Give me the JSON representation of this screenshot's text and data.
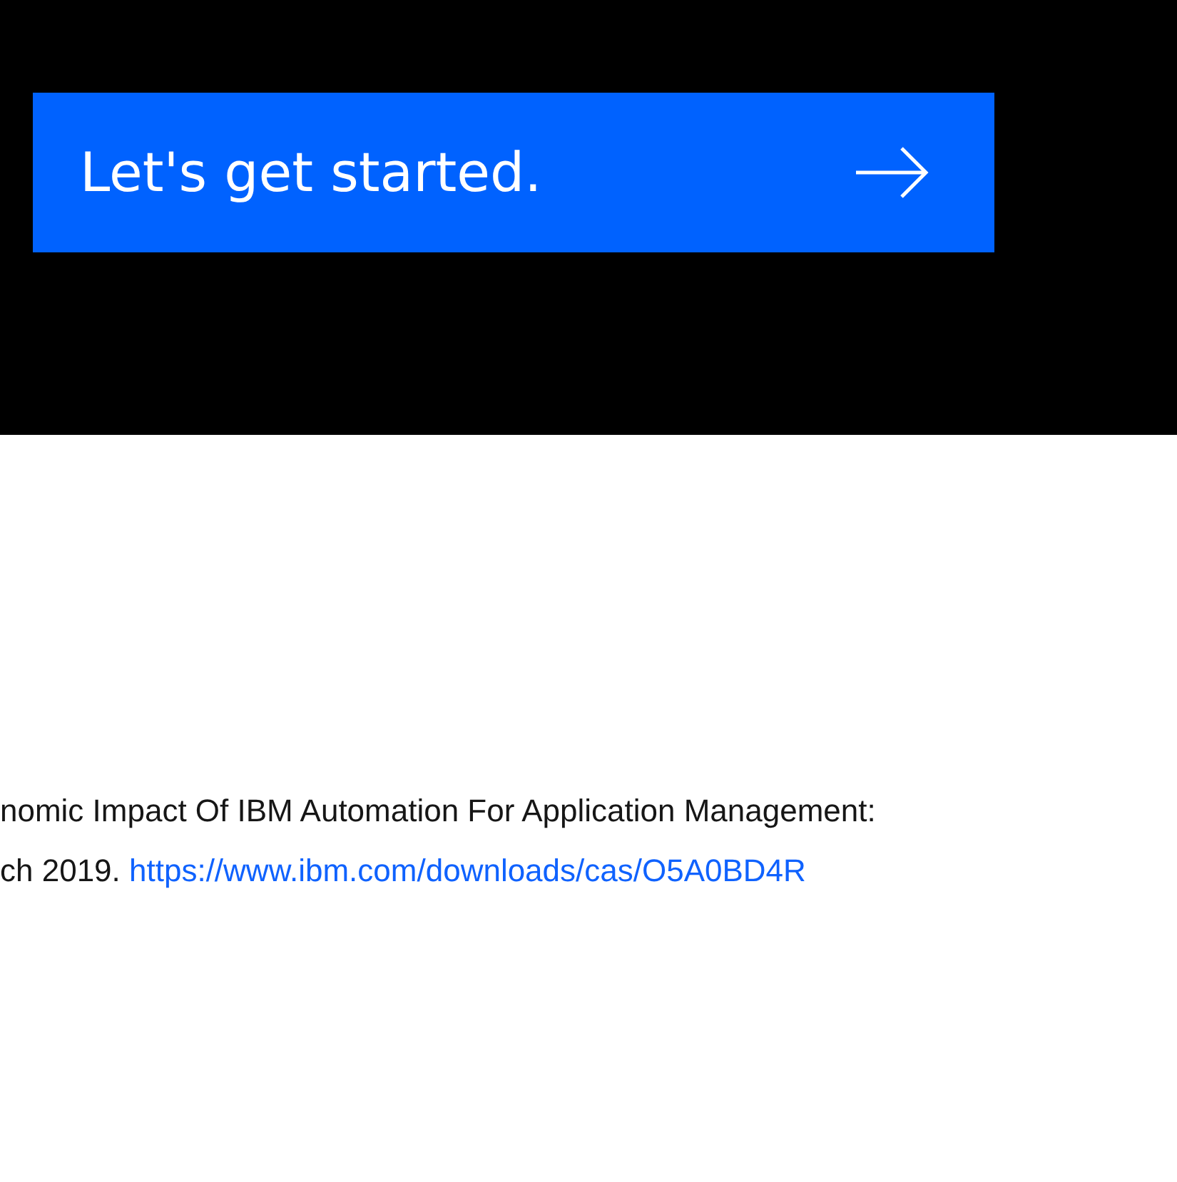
{
  "cta_banner": {
    "button": {
      "label": "Let's get started."
    }
  },
  "footnote": {
    "lines": [
      {
        "text": "nomic Impact Of IBM Automation For Application Management:"
      },
      {
        "text": "ch 2019. ",
        "link": "https://www.ibm.com/downloads/cas/O5A0BD4R"
      }
    ]
  }
}
